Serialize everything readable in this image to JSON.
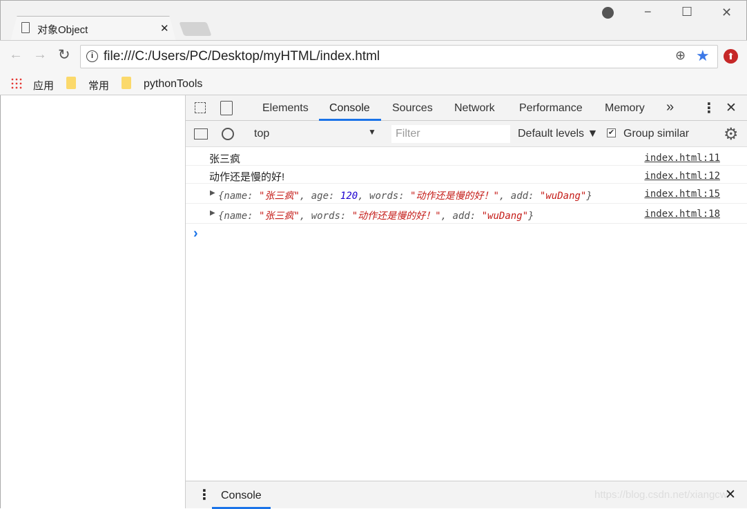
{
  "window": {
    "tab_title": "对象Object",
    "minimize": "−",
    "maximize": "☐",
    "close": "✕"
  },
  "toolbar": {
    "url": "file:///C:/Users/PC/Desktop/myHTML/index.html"
  },
  "bookmarks": [
    {
      "label": "应用"
    },
    {
      "label": "常用"
    },
    {
      "label": "pythonTools"
    }
  ],
  "devtools": {
    "tabs": [
      "Elements",
      "Console",
      "Sources",
      "Network",
      "Performance",
      "Memory"
    ],
    "active_tab": "Console",
    "more": "»",
    "context": "top",
    "filter_placeholder": "Filter",
    "levels": "Default levels ▼",
    "group_similar": "Group similar",
    "accent": "#1a73e8",
    "logs": [
      {
        "text": "张三疯",
        "source": "index.html:11"
      },
      {
        "text": "动作还是慢的好!",
        "source": "index.html:12"
      },
      {
        "parts": [
          [
            "{name: ",
            ""
          ],
          [
            "\"张三疯\"",
            "str"
          ],
          [
            ", age: ",
            ""
          ],
          [
            "120",
            "num"
          ],
          [
            ", words: ",
            ""
          ],
          [
            "\"动作还是慢的好！\"",
            "str"
          ],
          [
            ", add: ",
            ""
          ],
          [
            "\"wuDang\"",
            "str"
          ],
          [
            "}",
            ""
          ]
        ],
        "source": "index.html:15"
      },
      {
        "parts": [
          [
            "{name: ",
            ""
          ],
          [
            "\"张三疯\"",
            "str"
          ],
          [
            ", words: ",
            ""
          ],
          [
            "\"动作还是慢的好！\"",
            "str"
          ],
          [
            ", add: ",
            ""
          ],
          [
            "\"wuDang\"",
            "str"
          ],
          [
            "}",
            ""
          ]
        ],
        "source": "index.html:18"
      }
    ],
    "prompt": "›",
    "drawer_tab": "Console",
    "watermark": "https://blog.csdn.net/xiangcw/"
  }
}
